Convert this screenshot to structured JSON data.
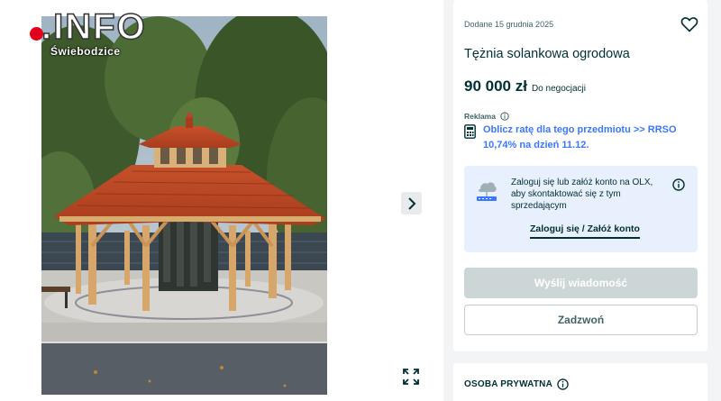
{
  "gallery": {
    "watermark_text": ".INFO",
    "watermark_subtext": "Świebodzice",
    "icons": {
      "next": "chevron-right-icon",
      "expand": "expand-icon"
    }
  },
  "listing": {
    "date": "Dodane 15 grudnia 2025",
    "title": "Tężnia solankowa ogrodowa",
    "price": "90 000 zł",
    "negotiable": "Do negocjacji",
    "ad_label": "Reklama",
    "rrso_link": "Oblicz ratę dla tego przedmiotu >> RRSO 10,74% na dzień 11.12.",
    "favorite_icon": "heart-icon"
  },
  "login_prompt": {
    "text": "Zaloguj się lub załóż konto na OLX, aby skontaktować się z tym sprzedającym",
    "link": "Zaloguj się / Załóż konto"
  },
  "buttons": {
    "message": "Wyślij wiadomość",
    "call": "Zadzwoń"
  },
  "seller": {
    "label": "OSOBA PRYWATNA"
  },
  "colors": {
    "accent_link": "#3a77ff",
    "text_primary": "#002f34",
    "login_box_bg": "#e8f0fe",
    "disabled_button": "#cdd6d7",
    "page_bg": "#f2f4f5"
  }
}
